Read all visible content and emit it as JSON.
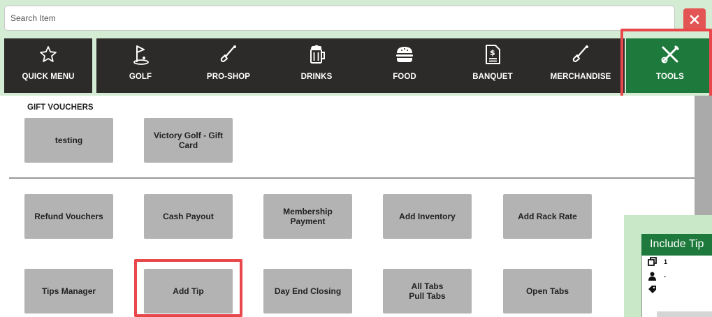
{
  "search": {
    "placeholder": "Search Item"
  },
  "categories": [
    {
      "label": "QUICK MENU",
      "icon": "star-icon"
    },
    {
      "label": "GOLF",
      "icon": "golf-icon"
    },
    {
      "label": "PRO-SHOP",
      "icon": "golf-club-icon"
    },
    {
      "label": "DRINKS",
      "icon": "beer-mug-icon"
    },
    {
      "label": "FOOD",
      "icon": "burger-icon"
    },
    {
      "label": "BANQUET",
      "icon": "invoice-icon"
    },
    {
      "label": "MERCHANDISE",
      "icon": "golf-club-icon"
    },
    {
      "label": "TOOLS",
      "icon": "tools-icon",
      "active": true
    }
  ],
  "gift_vouchers": {
    "title": "GIFT VOUCHERS",
    "items": [
      "testing",
      "Victory Golf - Gift\nCard"
    ]
  },
  "tools": {
    "row1": [
      "Refund Vouchers",
      "Cash Payout",
      "Membership Payment",
      "Add Inventory",
      "Add Rack Rate"
    ],
    "row2": [
      "Tips Manager",
      "Add Tip",
      "Day End Closing",
      "All Tabs\nPull Tabs",
      "Open Tabs"
    ]
  },
  "include_tip": {
    "title": "Include Tip",
    "rows": [
      {
        "icon": "copy-icon",
        "value": "1"
      },
      {
        "icon": "user-icon",
        "value": "-"
      },
      {
        "icon": "tag-icon",
        "value": ""
      }
    ]
  },
  "colors": {
    "background": "#d4ebd4",
    "category_bg": "#2c2b29",
    "active_category": "#1e7a3c",
    "button_bg": "#b3b3b3",
    "highlight": "#e8474b",
    "close_button": "#e35454"
  }
}
